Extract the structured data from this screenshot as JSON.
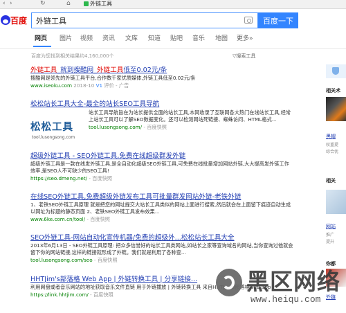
{
  "browser": {
    "tab_title": "外链工具",
    "shield_icon": "green-shield-icon"
  },
  "search": {
    "query": "外链工具",
    "button_label": "百度一下",
    "logo_text": "百度"
  },
  "tabs": [
    "网页",
    "图片",
    "视频",
    "资讯",
    "文库",
    "知道",
    "贴吧",
    "音乐",
    "地图",
    "更多»"
  ],
  "result_count": "百度为您找到相关结果约4,160,000个",
  "search_tools": "搜索工具",
  "results": [
    {
      "title_parts": [
        "外链工具",
        "_就到搜酷网_",
        "外链工具",
        "低至0.02元/条"
      ],
      "desc": "搜酷网是领先的外链工具平台,合作数千家优质媒体,外链工具低至0.02元/条",
      "url": "www.iseoku.com",
      "date": "2018-10",
      "badge": "V1",
      "extra": "评价 - 广告"
    },
    {
      "title": "松松站长工具大全-最全的站长SEO工具导航",
      "logo_big": "松松工具",
      "logo_small": "tool.lusongsong.com",
      "desc": "站长工具导航旨在为站长提供全面的站长工具,本网收录了互联网各大热门在线站长工具,经常上站长工具可以了解SEO数据变化。还可以检测网站死链接、蜘蛛访问、HTML格式...",
      "url": "tool.lusongsong.com/",
      "extra": "百度快照"
    },
    {
      "title": "超级外链工具 - SEO外链工具,免费在线超级群发外链",
      "desc": "超级外链工具是一款在线发外链工具,是全自动化超级SEO外链工具,可免费在线批量增加网站外链,大大提高发外链工作效率,是SEO人不可缺少的SEO工具!",
      "url": "https://seo.dmeng.net/",
      "extra": "百度快照"
    },
    {
      "title": "在线SEO外链工具,免费超级外链发布工具可批量群发网站外链-老铁外链",
      "desc": "1、老铁SEO外链工具原理 就是把您的网址提交大站长工具类似的网站上面进行搜索,然后就会在上面留下痕迹自动生成以网址为标题的静态页面 2、老铁SEO外链工具发布效果...",
      "url": "www.6ke.com.cn/tool/",
      "extra": "百度快照"
    },
    {
      "title": "SEO外链工具-网站自动化宣传机器/免费的超级外...松松站长工具大全",
      "desc": "2013年6月13日 - SEO外链工具原理: 把众多信誉好的站长工具类网站,如站长之家等查询域名的网站,当你查询过他就会留下你的网站链接,这样的链接就形成了外链。我们就是利用了各种查...",
      "url": "tool.lusongsong.com/seo",
      "extra": "百度快照"
    },
    {
      "title": "HHTJim's部落格 Web App | 外链转换工具 | 分享链接...",
      "desc": "利用网盘或者音乐网站的地址获取音乐文件直链 用于外链播放 | 外链转换工具 来自HHTJim's部落格web app",
      "url": "https://link.hhtjim.com/",
      "extra": "百度快照"
    }
  ],
  "right_col": {
    "heading1": "相关术",
    "link1": "黑帽",
    "small1": "权重提",
    "small2": "综合优",
    "heading2": "相关",
    "link2": "网站",
    "small3": "推广",
    "small4": "提升",
    "heading3": "你都",
    "link3": "外链"
  },
  "watermark": {
    "text": "黑区网络",
    "url": "www.heiqu.com"
  }
}
